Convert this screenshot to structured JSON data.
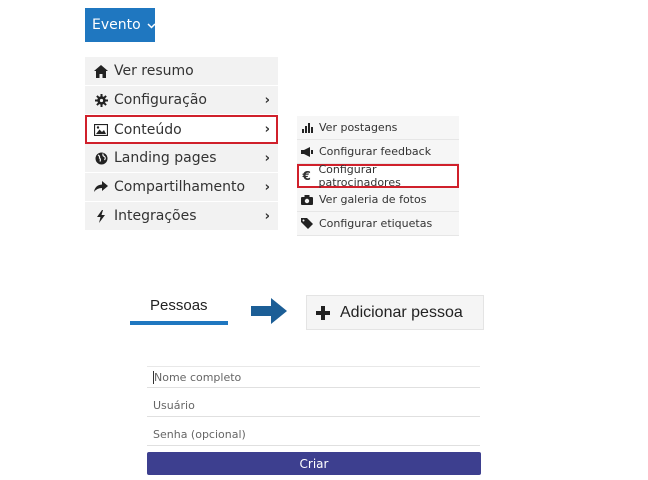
{
  "header": {
    "evento_label": "Evento",
    "chevron_icon": "chevron-down-icon"
  },
  "main_menu": {
    "items": [
      {
        "label": "Ver resumo",
        "icon": "home-icon",
        "has_submenu": false,
        "selected": false
      },
      {
        "label": "Configuração",
        "icon": "gear-icon",
        "has_submenu": true,
        "selected": false
      },
      {
        "label": "Conteúdo",
        "icon": "image-icon",
        "has_submenu": true,
        "selected": true
      },
      {
        "label": "Landing pages",
        "icon": "globe-icon",
        "has_submenu": true,
        "selected": false
      },
      {
        "label": "Compartilhamento",
        "icon": "share-icon",
        "has_submenu": true,
        "selected": false
      },
      {
        "label": "Integrações",
        "icon": "bolt-icon",
        "has_submenu": true,
        "selected": false
      }
    ],
    "submenu_arrow": "›"
  },
  "sub_menu": {
    "items": [
      {
        "label": "Ver postagens",
        "icon": "bars-icon",
        "selected": false
      },
      {
        "label": "Configurar feedback",
        "icon": "megaphone-icon",
        "selected": false
      },
      {
        "label": "Configurar patrocinadores",
        "icon": "euro-icon",
        "selected": true
      },
      {
        "label": "Ver galeria de fotos",
        "icon": "camera-icon",
        "selected": false
      },
      {
        "label": "Configurar etiquetas",
        "icon": "tags-icon",
        "selected": false
      }
    ]
  },
  "people": {
    "tab_label": "Pessoas",
    "add_button_label": "Adicionar pessoa",
    "arrow_icon": "arrow-right-icon"
  },
  "form": {
    "name_placeholder": "Nome completo",
    "user_placeholder": "Usuário",
    "password_placeholder": "Senha (opcional)",
    "submit_label": "Criar"
  },
  "colors": {
    "accent": "#1f77c0",
    "highlight": "#d0202b",
    "submit": "#3d3f8f",
    "arrow": "#1c5e96"
  }
}
